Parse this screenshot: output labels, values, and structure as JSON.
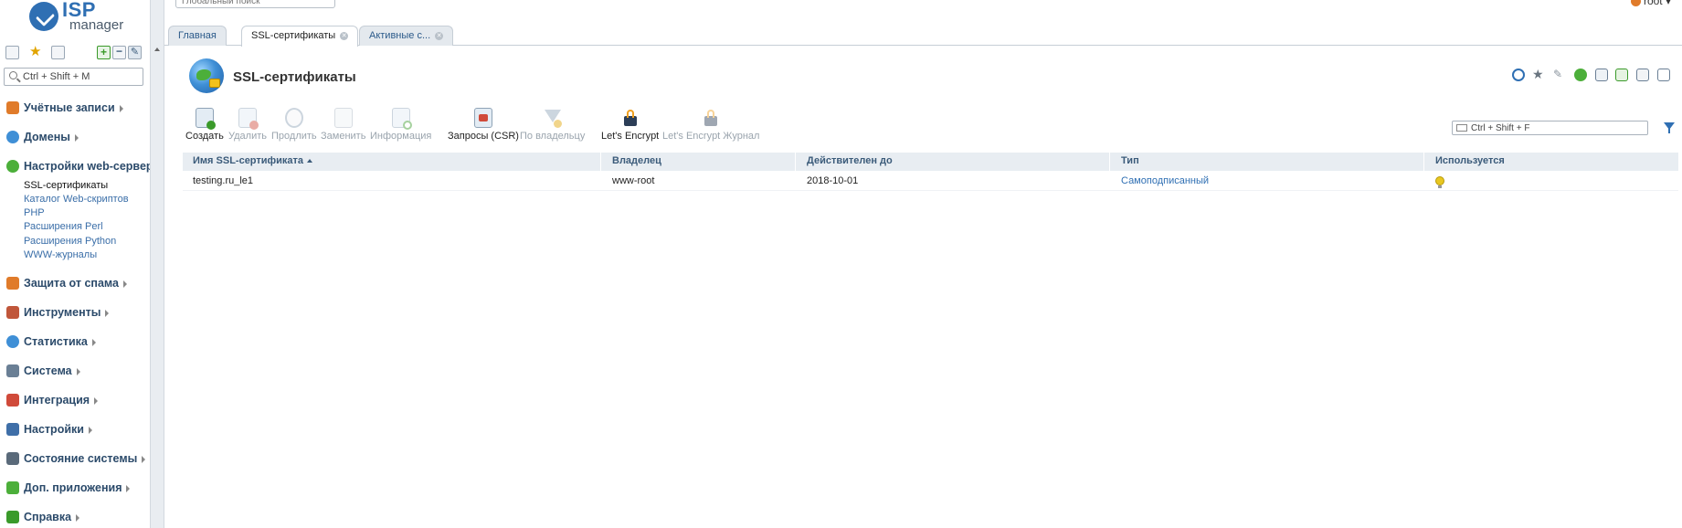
{
  "logo": {
    "top": "ISP",
    "bottom": "manager"
  },
  "sidebar": {
    "search_placeholder": "Ctrl + Shift + M",
    "menu": [
      {
        "label": "Учётные записи",
        "color": "#e07b2a"
      },
      {
        "label": "Домены",
        "color": "#3f8fd6"
      },
      {
        "label": "Настройки web-сервера",
        "color": "#4caf3a"
      },
      {
        "label": "Защита от спама",
        "color": "#e07b2a"
      },
      {
        "label": "Инструменты",
        "color": "#c0563a"
      },
      {
        "label": "Статистика",
        "color": "#3f8fd6"
      },
      {
        "label": "Система",
        "color": "#6a7f95"
      },
      {
        "label": "Интеграция",
        "color": "#d04a3a"
      },
      {
        "label": "Настройки",
        "color": "#3f6fa8"
      },
      {
        "label": "Состояние системы",
        "color": "#5a6a7a"
      },
      {
        "label": "Доп. приложения",
        "color": "#4caf3a"
      },
      {
        "label": "Справка",
        "color": "#3a9a2a"
      }
    ],
    "submenu": [
      {
        "label": "SSL-сертификаты",
        "active": true
      },
      {
        "label": "Каталог Web-скриптов"
      },
      {
        "label": "PHP"
      },
      {
        "label": "Расширения Perl"
      },
      {
        "label": "Расширения Python"
      },
      {
        "label": "WWW-журналы"
      }
    ]
  },
  "header": {
    "global_search_placeholder": "Глобальный поиск",
    "user": "root"
  },
  "tabs": [
    {
      "label": "Главная"
    },
    {
      "label": "SSL-сертификаты",
      "active": true
    },
    {
      "label": "Активные с..."
    }
  ],
  "page": {
    "title": "SSL-сертификаты"
  },
  "toolbar": {
    "actions": [
      {
        "label": "Создать",
        "enabled": true,
        "icon": "create-icon"
      },
      {
        "label": "Удалить",
        "enabled": false,
        "icon": "delete-icon"
      },
      {
        "label": "Продлить",
        "enabled": false,
        "icon": "renew-icon"
      },
      {
        "label": "Заменить",
        "enabled": false,
        "icon": "replace-icon"
      },
      {
        "label": "Информация",
        "enabled": false,
        "icon": "info-icon"
      },
      {
        "label": "Запросы (CSR)",
        "enabled": true,
        "icon": "csr-icon"
      },
      {
        "label": "По владельцу",
        "enabled": false,
        "icon": "filter-owner-icon"
      },
      {
        "label": "Let's Encrypt",
        "enabled": true,
        "icon": "letsencrypt-icon"
      },
      {
        "label": "Let's Encrypt Журнал",
        "enabled": false,
        "icon": "letsencrypt-log-icon"
      }
    ],
    "filter_placeholder": "Ctrl + Shift + F"
  },
  "table": {
    "columns": [
      "Имя SSL-сертификата",
      "Владелец",
      "Действителен до",
      "Тип",
      "Используется"
    ],
    "rows": [
      {
        "name": "testing.ru_le1",
        "owner": "www-root",
        "valid_until": "2018-10-01",
        "type": "Самоподписанный",
        "in_use": true
      }
    ]
  }
}
